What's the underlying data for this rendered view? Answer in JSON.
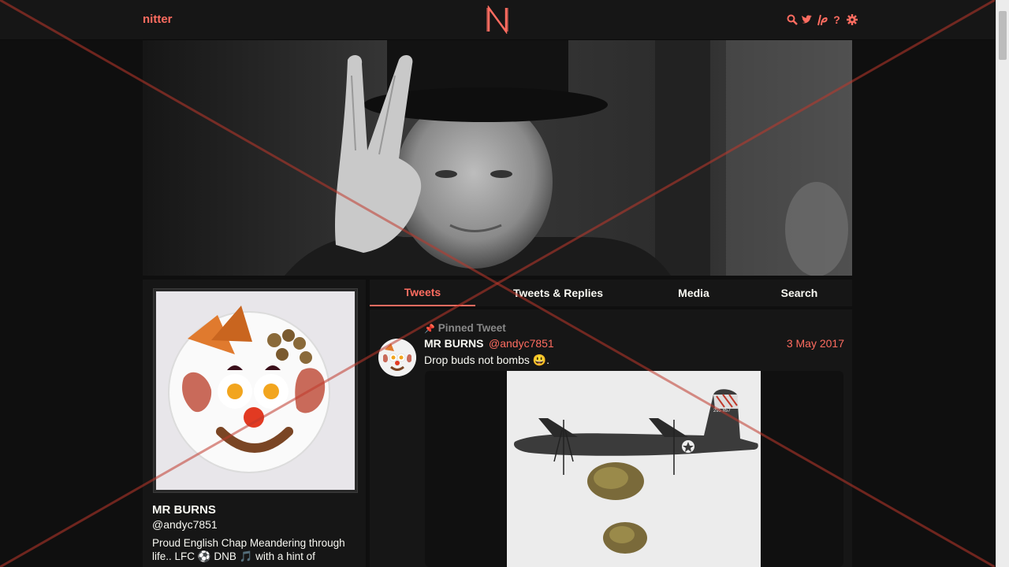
{
  "nav": {
    "brand": "nitter",
    "logo_letter": "N",
    "icons": [
      "search-icon",
      "twitter-bird-icon",
      "rss-icon",
      "help-icon",
      "settings-gear-icon"
    ]
  },
  "profile": {
    "name": "MR BURNS",
    "handle": "@andyc7851",
    "bio": "Proud English Chap Meandering through life.. LFC ⚽ DNB 🎵 with a hint of"
  },
  "tabs": [
    {
      "label": "Tweets",
      "active": true
    },
    {
      "label": "Tweets & Replies",
      "active": false
    },
    {
      "label": "Media",
      "active": false
    },
    {
      "label": "Search",
      "active": false
    }
  ],
  "tweet": {
    "pinned_label": "Pinned Tweet",
    "name": "MR BURNS",
    "handle": "@andyc7851",
    "date": "3 May 2017",
    "text": "Drop buds not bombs 😃.",
    "aircraft_marking": "295 857"
  },
  "colors": {
    "accent": "#ff6c60",
    "background": "#0f0f0f",
    "panel": "#161616",
    "text": "#f8f8f2"
  }
}
